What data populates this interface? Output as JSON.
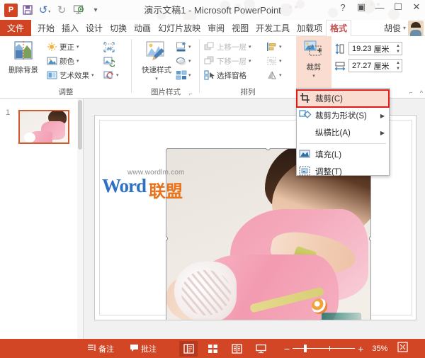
{
  "window": {
    "title": "演示文稿1 - Microsoft PowerPoint",
    "help": "?",
    "ribbon_display": "▣",
    "minimize": "—",
    "maximize": "☐",
    "close": "✕"
  },
  "qat": {
    "logo": "P",
    "save": "save-icon",
    "undo": "↺",
    "undo_caret": "▾",
    "redo": "↻",
    "present": "present-icon",
    "more": "▾"
  },
  "tabs": {
    "file": "文件",
    "items": [
      {
        "label": "开始",
        "active": false
      },
      {
        "label": "插入",
        "active": false
      },
      {
        "label": "设计",
        "active": false
      },
      {
        "label": "切换",
        "active": false
      },
      {
        "label": "动画",
        "active": false
      },
      {
        "label": "幻灯片放映",
        "active": false
      },
      {
        "label": "审阅",
        "active": false
      },
      {
        "label": "视图",
        "active": false
      },
      {
        "label": "开发工具",
        "active": false
      },
      {
        "label": "加载项",
        "active": false
      },
      {
        "label": "格式",
        "active": true
      }
    ],
    "user": "胡俊",
    "user_caret": "▾"
  },
  "ribbon": {
    "groups": [
      {
        "name": "调整",
        "label": "调整"
      },
      {
        "name": "图片样式",
        "label": "图片样式"
      },
      {
        "name": "排列",
        "label": "排列"
      }
    ],
    "remove_background": "删除背景",
    "corrections": "更正",
    "color": "颜色",
    "artistic_effects": "艺术效果",
    "quick_styles": "快速样式",
    "bring_forward": "上移一层",
    "send_backward": "下移一层",
    "selection_pane": "选择窗格",
    "crop_button": "裁剪",
    "crop_caret": "▾",
    "height_value": "19.23",
    "height_unit": "厘米",
    "width_value": "27.27",
    "width_unit": "厘米",
    "caret": "▾",
    "dialog_launcher": "⌐"
  },
  "menu": {
    "items": [
      {
        "label": "裁剪(C)",
        "icon": "crop-icon",
        "arrow": "",
        "highlighted": true
      },
      {
        "label": "裁剪为形状(S)",
        "icon": "crop-to-shape-icon",
        "arrow": "▶",
        "highlighted": false
      },
      {
        "label": "纵横比(A)",
        "icon": "",
        "arrow": "▶",
        "highlighted": false
      },
      {
        "label": "填充(L)",
        "icon": "fill-icon",
        "arrow": "",
        "highlighted": false
      },
      {
        "label": "调整(T)",
        "icon": "fit-icon",
        "arrow": "",
        "highlighted": false
      }
    ]
  },
  "thumbnails": {
    "slides": [
      {
        "number": "1"
      }
    ]
  },
  "slide": {
    "watermark_url": "www.wordlm.com",
    "watermark_word": "Word",
    "watermark_lm": "联盟",
    "rotate_handle": "↻"
  },
  "statusbar": {
    "notes": "备注",
    "comments": "批注",
    "views": [
      {
        "name": "normal-view",
        "glyph": "▤",
        "active": true
      },
      {
        "name": "slide-sorter-view",
        "glyph": "▦",
        "active": false
      },
      {
        "name": "reading-view",
        "glyph": "▥",
        "active": false
      },
      {
        "name": "slideshow-view",
        "glyph": "▱",
        "active": false
      }
    ],
    "zoom_out": "−",
    "zoom_in": "+",
    "zoom_percent": "35%",
    "fit_window": "⛶"
  },
  "colors": {
    "accent": "#d04423",
    "status_bar": "#d24625",
    "highlight": "#fbdcd0",
    "highlight_border": "#e01b1b",
    "tab_active_text": "#c0504d"
  }
}
